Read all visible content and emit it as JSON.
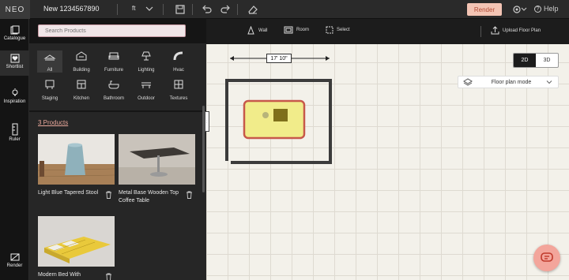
{
  "app": {
    "logo": "NEO",
    "project_name": "New 1234567890",
    "unit": "ft"
  },
  "top": {
    "render_label": "Render",
    "help_label": "Help"
  },
  "rail": [
    {
      "label": "Catalogue",
      "icon": "catalogue-icon"
    },
    {
      "label": "Shortlist",
      "icon": "heart-icon"
    },
    {
      "label": "Inspiration",
      "icon": "bulb-icon"
    },
    {
      "label": "Ruler",
      "icon": "ruler-icon"
    },
    {
      "label": "Render",
      "icon": "render-icon"
    }
  ],
  "search": {
    "placeholder": "Search Products"
  },
  "categories": [
    {
      "label": "All",
      "icon": "all-icon"
    },
    {
      "label": "Building",
      "icon": "building-icon"
    },
    {
      "label": "Furniture",
      "icon": "armchair-icon"
    },
    {
      "label": "Lighting",
      "icon": "lamp-icon"
    },
    {
      "label": "Hvac",
      "icon": "hvac-icon"
    },
    {
      "label": "Staging",
      "icon": "staging-icon"
    },
    {
      "label": "Kitchen",
      "icon": "kitchen-icon"
    },
    {
      "label": "Bathroom",
      "icon": "bathtub-icon"
    },
    {
      "label": "Outdoor",
      "icon": "bench-icon"
    },
    {
      "label": "Textures",
      "icon": "texture-icon"
    }
  ],
  "products": {
    "count_label": "3 Products",
    "items": [
      {
        "name": "Light Blue Tapered Stool"
      },
      {
        "name": "Metal Base Wooden Top Coffee Table"
      },
      {
        "name": "Modern Bed With"
      }
    ]
  },
  "toolbar": {
    "wall": "Wall",
    "room": "Room",
    "select": "Select",
    "upload": "Upload Floor Plan"
  },
  "view": {
    "mode_2d": "2D",
    "mode_3d": "3D",
    "floor_plan_mode": "Floor plan mode"
  },
  "measurement": "17' 10\"",
  "colors": {
    "accent": "#f3c4b4",
    "accent_text": "#b24b34",
    "link": "#e8a79a",
    "selection": "#c7584a"
  }
}
